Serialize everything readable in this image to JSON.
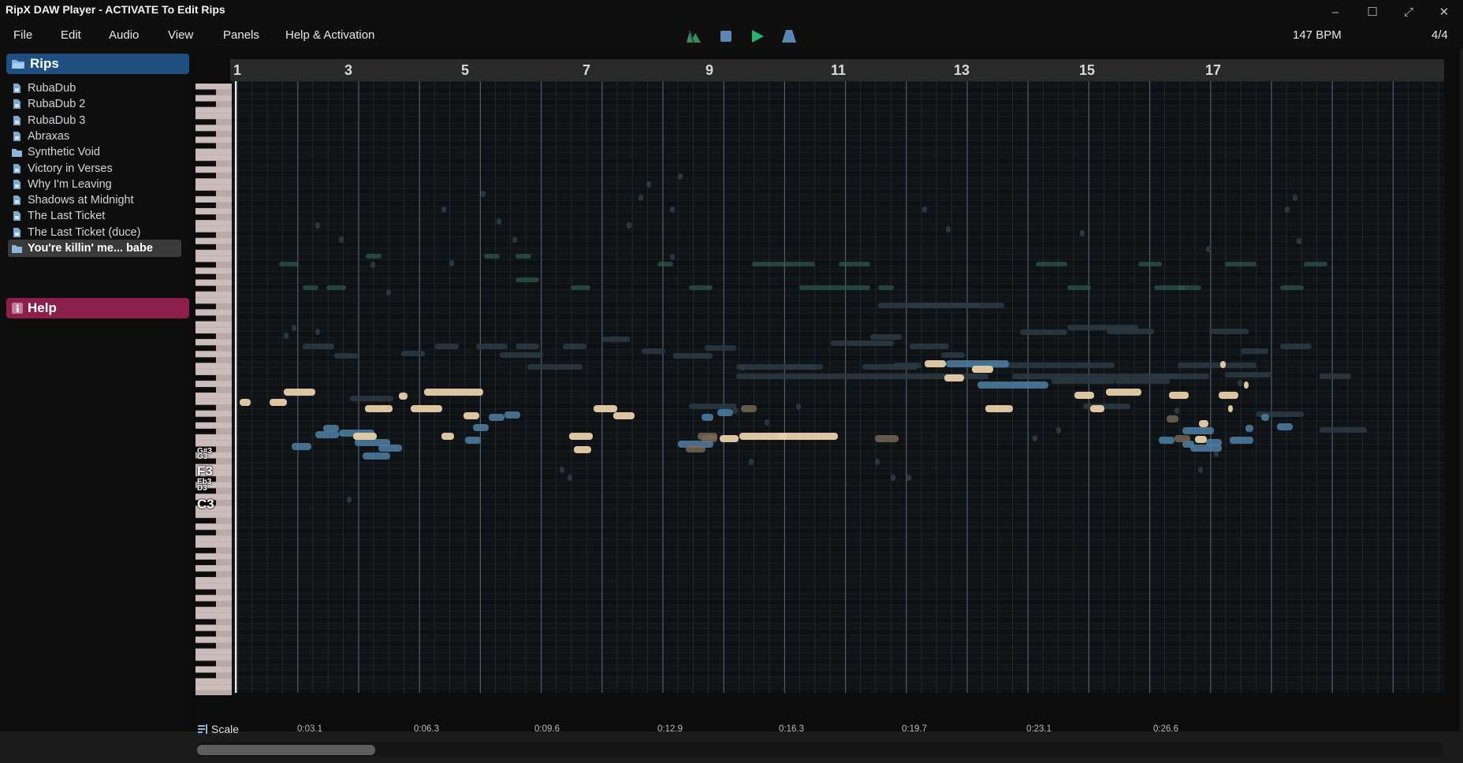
{
  "window": {
    "title": "RipX DAW Player - ACTIVATE To Edit Rips"
  },
  "menu": {
    "items": [
      "File",
      "Edit",
      "Audio",
      "View",
      "Panels",
      "Help & Activation"
    ]
  },
  "transport": {
    "bpm": "147 BPM",
    "time_signature": "4/4",
    "icons": [
      "harmonic-icon",
      "stop-icon",
      "play-icon",
      "metronome-icon"
    ]
  },
  "sidebar": {
    "rips_title": "Rips",
    "help_title": "Help",
    "rips": [
      {
        "label": "RubaDub",
        "type": "file"
      },
      {
        "label": "RubaDub 2",
        "type": "file"
      },
      {
        "label": "RubaDub 3",
        "type": "file"
      },
      {
        "label": "Abraxas",
        "type": "file"
      },
      {
        "label": "Synthetic Void",
        "type": "folder"
      },
      {
        "label": "Victory in Verses",
        "type": "file"
      },
      {
        "label": "Why I'm Leaving",
        "type": "file"
      },
      {
        "label": "Shadows at Midnight",
        "type": "file"
      },
      {
        "label": "The Last Ticket",
        "type": "file"
      },
      {
        "label": "The Last Ticket (duce)",
        "type": "file"
      },
      {
        "label": "You're killin' me... babe",
        "type": "folder",
        "selected": true
      }
    ]
  },
  "editor": {
    "bar_numbers": [
      "1",
      "3",
      "5",
      "7",
      "9",
      "11",
      "13",
      "15",
      "17"
    ],
    "time_labels": [
      "0:03.1",
      "0:06.3",
      "0:09.6",
      "0:12.9",
      "0:16.3",
      "0:19.7",
      "0:23.1",
      "0:26.6"
    ],
    "key_labels": [
      "G#3",
      "G3",
      "F3",
      "Eb3",
      "D3",
      "C3"
    ],
    "scale_label": "Scale"
  },
  "colors": {
    "rips_header": "#1f4f80",
    "help_header": "#8a1f49",
    "note_vocal": "#e8cfa8",
    "note_bass": "#4f7fa3",
    "note_dim": "#2c3a44",
    "note_green": "#2f5a4e",
    "play_green": "#2bb36b"
  }
}
